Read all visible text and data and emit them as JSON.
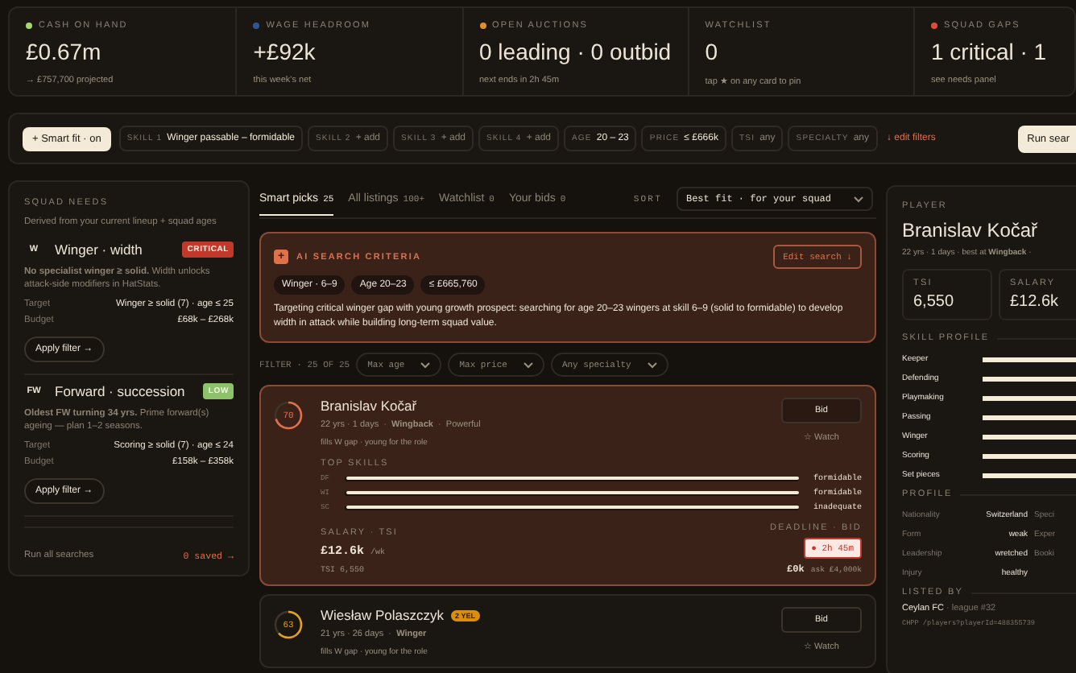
{
  "stats": [
    {
      "label": "CASH ON HAND",
      "color": "#a6d96a",
      "value": "£0.67m",
      "note": "→ £757,700 projected"
    },
    {
      "label": "WAGE HEADROOM",
      "color": "#2f5596",
      "value": "+£92k",
      "note": "this week's net"
    },
    {
      "label": "OPEN AUCTIONS",
      "color": "#e0902a",
      "value": "0 leading · 0 outbid",
      "note": "next ends in 2h 45m"
    },
    {
      "label": "WATCHLIST",
      "value": "0",
      "note": "tap ★ on any card to pin"
    },
    {
      "label": "SQUAD GAPS",
      "color": "#e04a3a",
      "value": "1 critical · 1",
      "note": "see needs panel"
    }
  ],
  "filters": {
    "smart_fit": {
      "icon": "+",
      "label": "Smart fit · on"
    },
    "chips": [
      {
        "key": "SKILL 1",
        "value": "Winger passable – formidable",
        "set": true
      },
      {
        "key": "SKILL 2",
        "value": "+ add",
        "set": false
      },
      {
        "key": "SKILL 3",
        "value": "+ add",
        "set": false
      },
      {
        "key": "SKILL 4",
        "value": "+ add",
        "set": false
      },
      {
        "key": "AGE",
        "value": "20 – 23",
        "set": true
      },
      {
        "key": "PRICE",
        "value": "≤ £666k",
        "set": true
      },
      {
        "key": "TSI",
        "value": "any",
        "set": false
      },
      {
        "key": "SPECIALTY",
        "value": "any",
        "set": false
      }
    ],
    "edit": "↓ edit filters",
    "run": "Run sear"
  },
  "needs": {
    "title": "SQUAD NEEDS",
    "subtitle": "Derived from your current lineup + squad ages",
    "items": [
      {
        "icon": "W",
        "title": "Winger · width",
        "color": "#c0392b",
        "badge": "CRITICAL",
        "text": "**No specialist winger ≥ solid.** Width unlocks attack-side modifiers in HatStats.",
        "rows": [
          {
            "label": "Target",
            "value": "Winger ≥ solid (7) · age ≤ 25"
          },
          {
            "label": "Budget",
            "value": "£68k – £268k"
          }
        ],
        "action": "Apply filter →"
      },
      {
        "icon": "FW",
        "title": "Forward · succession",
        "color": "#8bc26a",
        "badge": "LOW",
        "text": "**Oldest FW turning 34 yrs.** Prime forward(s) ageing — plan 1–2 seasons.",
        "rows": [
          {
            "label": "Target",
            "value": "Scoring ≥ solid (7) · age ≤ 24"
          },
          {
            "label": "Budget",
            "value": "£158k – £358k"
          }
        ],
        "action": "Apply filter →"
      }
    ],
    "run_all": "Run all searches",
    "saved": "0 saved →"
  },
  "tabs": [
    {
      "label": "Smart picks",
      "count": "25",
      "selected": true
    },
    {
      "label": "All listings",
      "count": "100+",
      "selected": false
    },
    {
      "label": "Watchlist",
      "count": "0",
      "selected": false
    },
    {
      "label": "Your bids",
      "count": "0",
      "selected": false
    }
  ],
  "sort": {
    "label": "SORT",
    "value": "Best fit · for your squad"
  },
  "criteria": {
    "icon": "+",
    "title": "AI SEARCH CRITERIA",
    "edit": "Edit search ↓",
    "tags": [
      "Winger · 6–9",
      "Age 20–23",
      "≤ £665,760"
    ],
    "text": "Targeting critical winger gap with young growth prospect: searching for age 20–23 wingers at skill 6–9 (solid to formidable) to develop width in attack while building long-term squad value."
  },
  "filter_row": {
    "label": "FILTER · 25 OF 25",
    "selects": [
      "Max age",
      "Max price",
      "Any specialty"
    ]
  },
  "players": [
    {
      "score": "70",
      "color": "#e0704a",
      "name": "Branislav Kočař",
      "meta": "22 yrs · 1 days  ·  **Wingback**  ·  Powerful",
      "fit": "fills W gap · young for the role",
      "selected": true,
      "bid_button": "Bid",
      "watch": "☆ Watch",
      "skills_label": "TOP SKILLS",
      "skills": [
        {
          "code": "DF",
          "level": 1,
          "rating": "formidable"
        },
        {
          "code": "WI",
          "level": 1,
          "rating": "formidable"
        },
        {
          "code": "SC",
          "level": 1,
          "rating": "inadequate"
        }
      ],
      "salary_label": "SALARY · TSI",
      "salary": "£12.6k",
      "salary_unit": "/wk",
      "tsi": "TSI 6,550",
      "deadline_label": "DEADLINE · BID",
      "deadline": "● 2h 45m",
      "bid": "£0k",
      "ask": "ask £4,000k"
    },
    {
      "score": "63",
      "color": "#e0a020",
      "name": "Wiesław Polaszczyk",
      "badge": "2 YEL",
      "meta": "21 yrs · 26 days  ·  **Winger**",
      "fit": "fills W gap · young for the role",
      "selected": false,
      "bid_button": "Bid",
      "watch": "☆ Watch"
    }
  ],
  "player": {
    "label": "PLAYER",
    "name": "Branislav Kočař",
    "meta": "22 yrs · 1 days · best at **Wingback** ·",
    "stats": [
      {
        "label": "TSI",
        "value": "6,550"
      },
      {
        "label": "SALARY",
        "value": "£12.6k"
      }
    ],
    "skill_title": "SKILL PROFILE",
    "skills": [
      {
        "name": "Keeper",
        "level": 1
      },
      {
        "name": "Defending",
        "level": 1
      },
      {
        "name": "Playmaking",
        "level": 1
      },
      {
        "name": "Passing",
        "level": 1
      },
      {
        "name": "Winger",
        "level": 1
      },
      {
        "name": "Scoring",
        "level": 1
      },
      {
        "name": "Set pieces",
        "level": 1
      }
    ],
    "profile_title": "PROFILE",
    "profile": [
      {
        "label": "Nationality",
        "value": "Switzerland",
        "next": "Speci"
      },
      {
        "label": "Form",
        "value": "weak",
        "next": "Exper"
      },
      {
        "label": "Leadership",
        "value": "wretched",
        "next": "Booki"
      },
      {
        "label": "Injury",
        "value": "healthy"
      }
    ],
    "listed_title": "LISTED BY",
    "club": "Ceylan FC",
    "league": "· league #32",
    "link": "CHPP /players?playerId=488355739"
  }
}
